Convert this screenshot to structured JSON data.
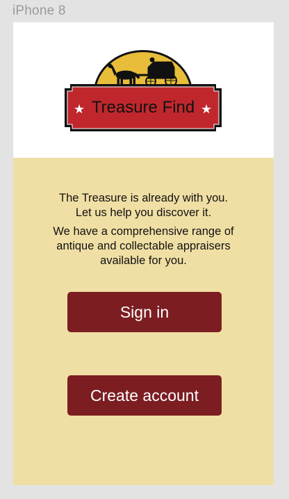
{
  "frame": {
    "label": "iPhone 8"
  },
  "logo": {
    "text": "Treasure Find",
    "star": "★"
  },
  "intro": {
    "line1": "The Treasure is already with you.",
    "line2": "Let us help you discover it.",
    "line3": "We have a comprehensive range of",
    "line4": "antique and collectable appraisers",
    "line5": "available for you."
  },
  "actions": {
    "sign_in_label": "Sign in",
    "create_account_label": "Create account"
  },
  "colors": {
    "background": "#f0dfa4",
    "button": "#7c1d22",
    "logo_red": "#c0272d",
    "logo_gold": "#e8bd3a"
  }
}
